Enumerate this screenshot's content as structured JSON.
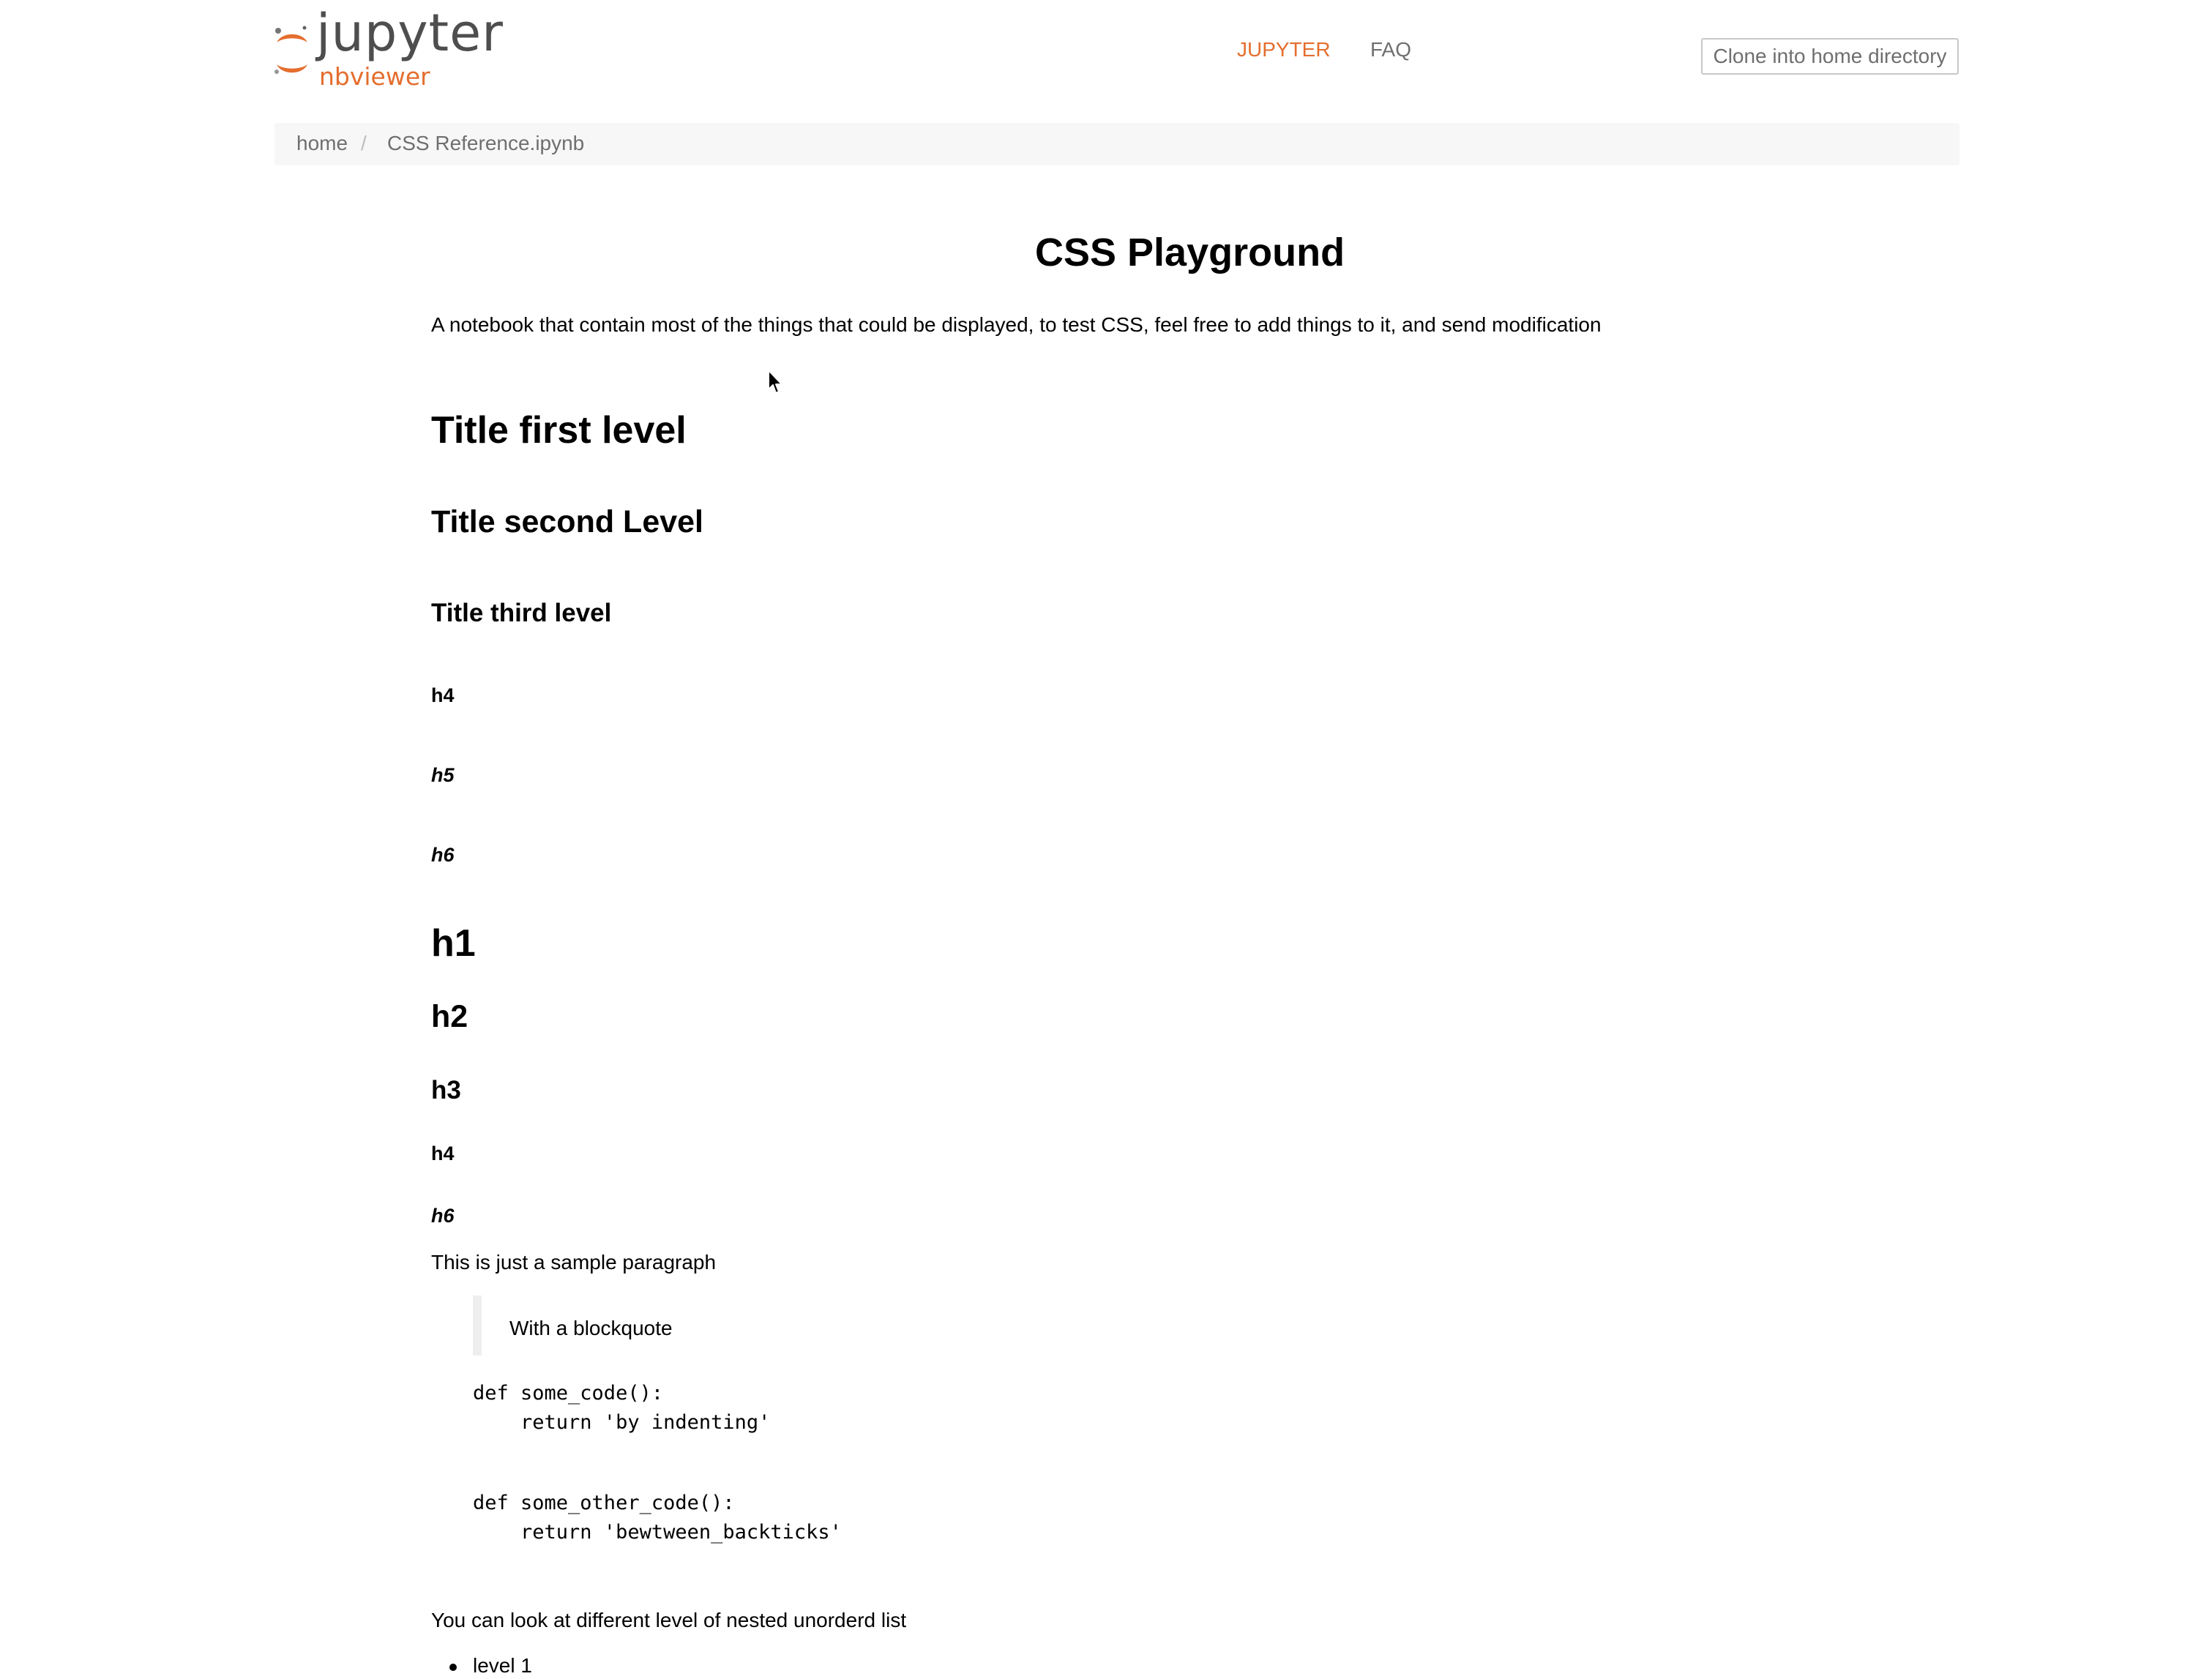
{
  "header": {
    "logo_word": "jupyter",
    "logo_sub": "nbviewer",
    "nav": [
      {
        "label": "JUPYTER"
      },
      {
        "label": "FAQ"
      }
    ],
    "clone_button_label": "Clone into home directory"
  },
  "breadcrumb": {
    "items": [
      "home",
      "CSS Reference.ipynb"
    ],
    "separator": "/"
  },
  "notebook": {
    "title": "CSS Playground",
    "intro": "A notebook that contain most of the things that could be displayed, to test CSS, feel free to add things to it, and send modification",
    "headings": {
      "title_first": "Title first level",
      "title_second": "Title second Level",
      "title_third": "Title third level",
      "h4_first": "h4",
      "h5": "h5",
      "h6_first": "h6",
      "h1": "h1",
      "h2": "h2",
      "h3": "h3",
      "h4_second": "h4",
      "h6_second": "h6"
    },
    "paragraph": "This is just a sample paragraph",
    "blockquote": "With a blockquote",
    "code_block_1": "def some_code():\n    return 'by indenting'",
    "code_block_2": "def some_other_code():\n    return 'bewtween_backticks'",
    "list_intro": "You can look at different level of nested unorderd list",
    "list_items": [
      "level 1"
    ]
  },
  "colors": {
    "brand_orange": "#e46e2e",
    "nav_gray": "#6f6f6f",
    "breadcrumb_bg": "#f7f7f7"
  },
  "icons": {
    "logo": "jupyter-logo-icon",
    "cursor": "mouse-pointer-icon"
  }
}
